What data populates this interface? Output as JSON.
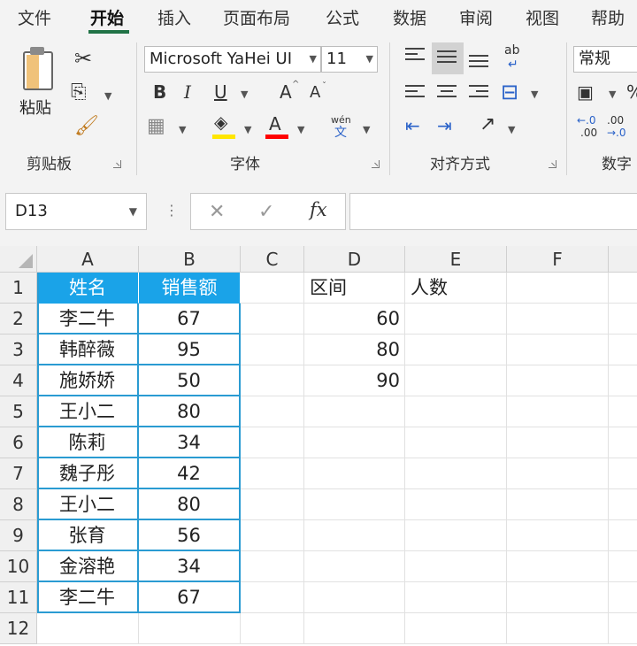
{
  "menu": {
    "tabs": [
      {
        "label": "文件",
        "active": false
      },
      {
        "label": "开始",
        "active": true
      },
      {
        "label": "插入",
        "active": false
      },
      {
        "label": "页面布局",
        "active": false
      },
      {
        "label": "公式",
        "active": false
      },
      {
        "label": "数据",
        "active": false
      },
      {
        "label": "审阅",
        "active": false
      },
      {
        "label": "视图",
        "active": false
      },
      {
        "label": "帮助",
        "active": false
      }
    ]
  },
  "ribbon": {
    "clipboard": {
      "paste_label": "粘贴",
      "group_label": "剪贴板"
    },
    "font": {
      "font_name": "Microsoft YaHei UI",
      "font_size": "11",
      "group_label": "字体",
      "bold": "B",
      "italic": "I",
      "underline": "U",
      "grow": "A",
      "shrink": "A",
      "font_color_glyph": "A",
      "phonetic": "wén",
      "phonetic_char": "文",
      "highlight_color": "#ffe600",
      "font_color": "#ff0000"
    },
    "alignment": {
      "group_label": "对齐方式",
      "wrap_glyph": "ab"
    },
    "number": {
      "format": "常规",
      "group_label": "数字",
      "inc_decimal": "←.0\n.00",
      "dec_decimal": ".00\n→.0"
    }
  },
  "formula_bar": {
    "name_box": "D13",
    "fx": "fx",
    "formula": ""
  },
  "sheet": {
    "columns": [
      "A",
      "B",
      "C",
      "D",
      "E",
      "F"
    ],
    "rows": [
      "1",
      "2",
      "3",
      "4",
      "5",
      "6",
      "7",
      "8",
      "9",
      "10",
      "11",
      "12"
    ],
    "header_fill": "#1aa3e8",
    "table": {
      "headers": [
        "姓名",
        "销售额"
      ],
      "records": [
        [
          "李二牛",
          "67"
        ],
        [
          "韩醉薇",
          "95"
        ],
        [
          "施娇娇",
          "50"
        ],
        [
          "王小二",
          "80"
        ],
        [
          "陈莉",
          "34"
        ],
        [
          "魏子彤",
          "42"
        ],
        [
          "王小二",
          "80"
        ],
        [
          "张育",
          "56"
        ],
        [
          "金溶艳",
          "34"
        ],
        [
          "李二牛",
          "67"
        ]
      ]
    },
    "interval": {
      "header": "区间",
      "values": [
        "60",
        "80",
        "90"
      ]
    },
    "count_header": "人数"
  }
}
